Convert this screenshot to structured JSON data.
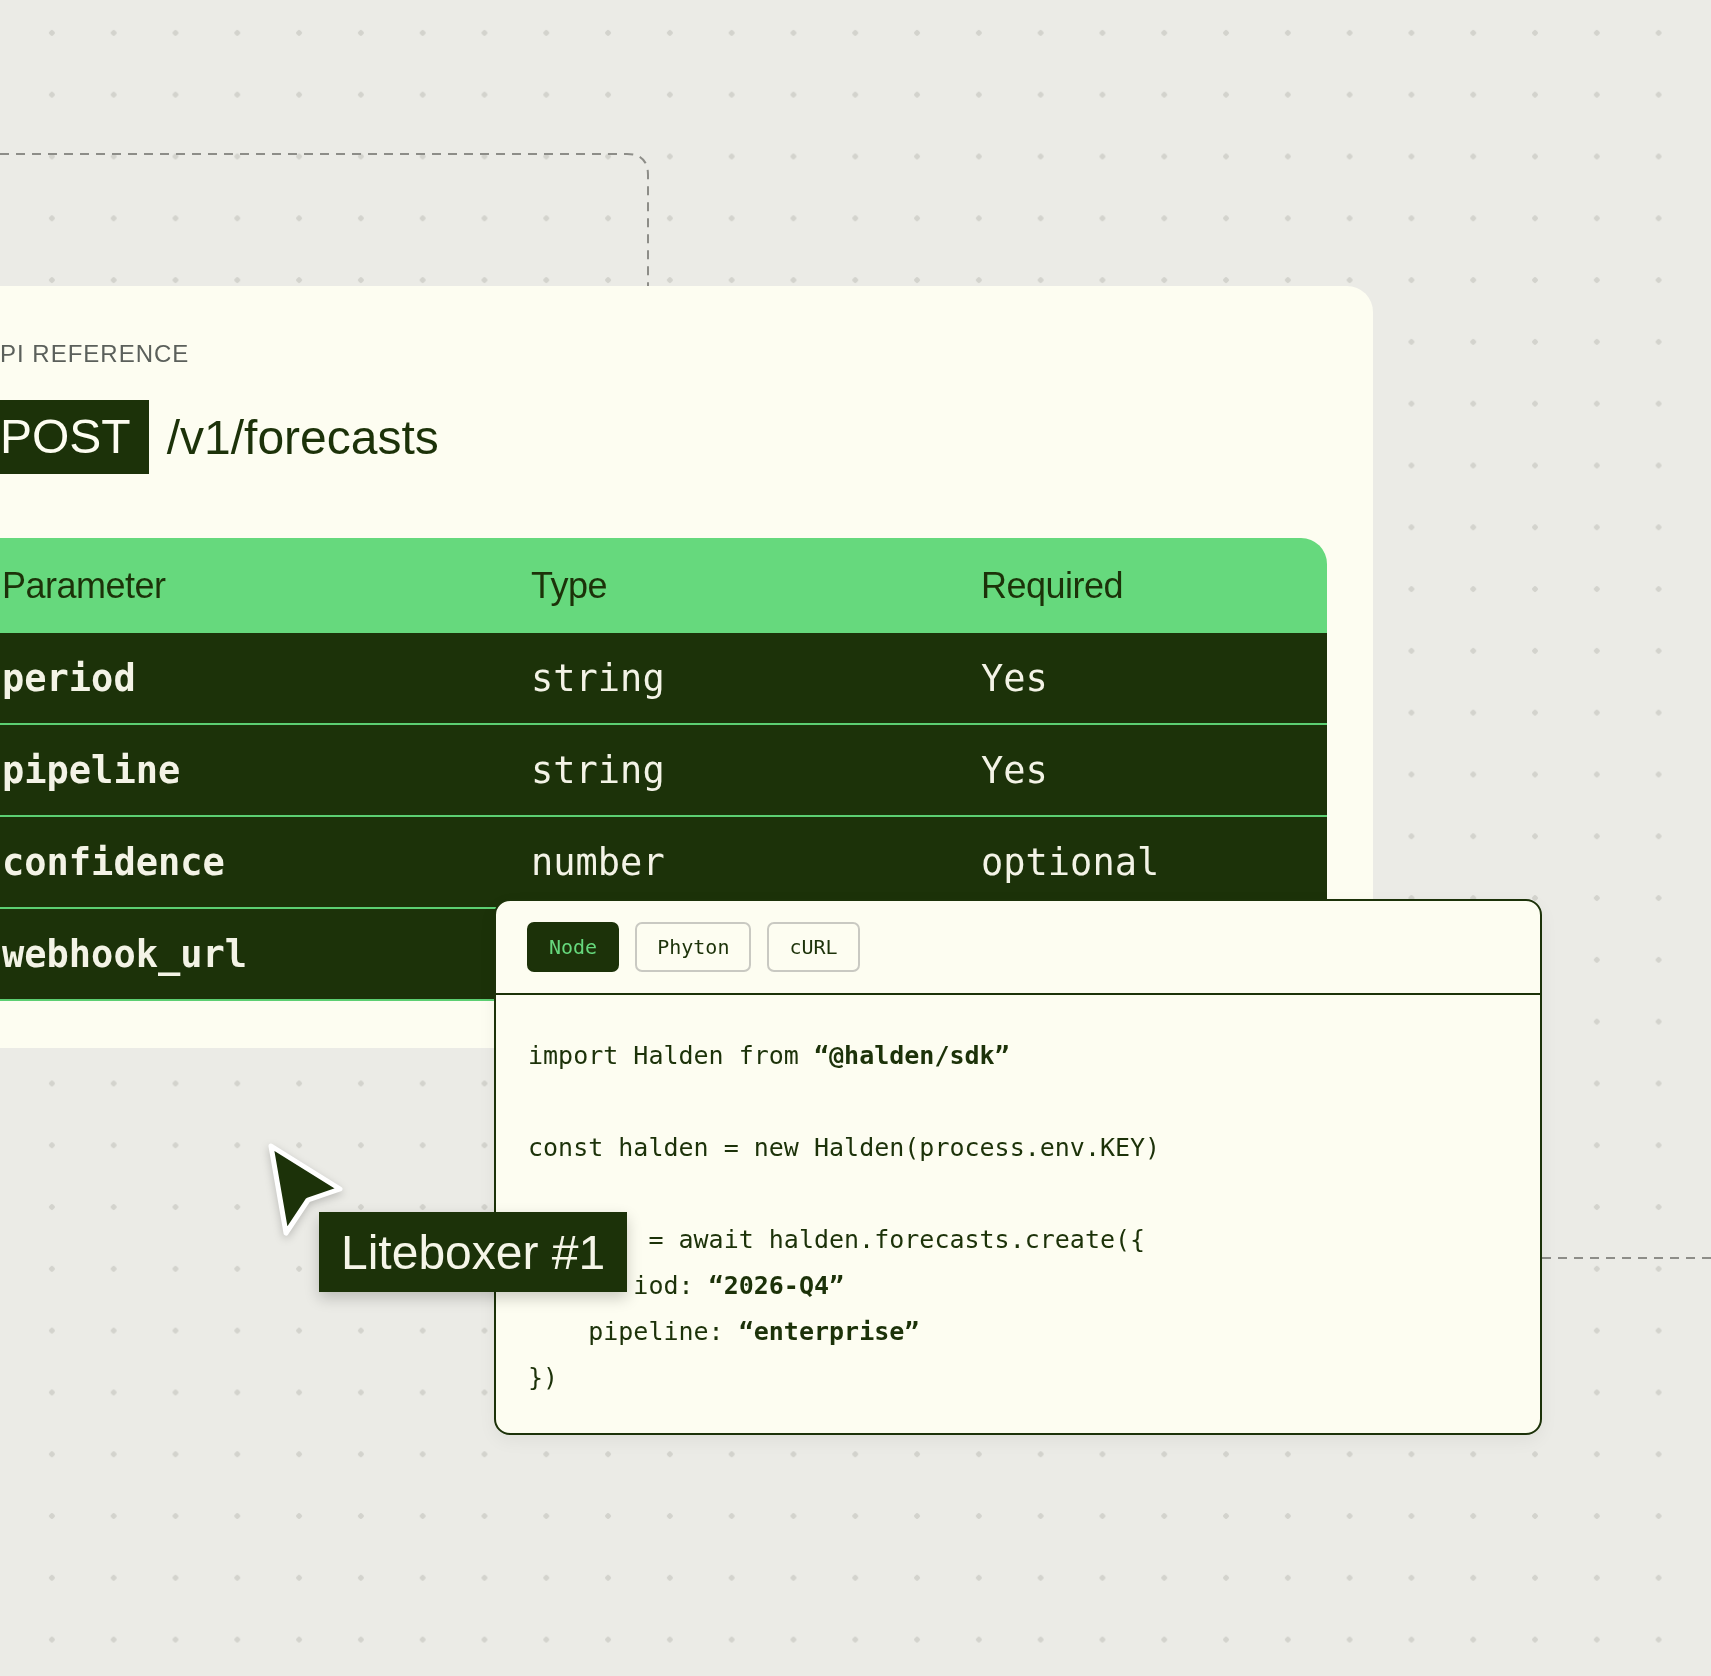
{
  "eyebrow": "PI REFERENCE",
  "endpoint": {
    "method": "POST",
    "path": "/v1/forecasts"
  },
  "table": {
    "columns": [
      "Parameter",
      "Type",
      "Required"
    ],
    "rows": [
      {
        "parameter": "period",
        "type": "string",
        "required": "Yes"
      },
      {
        "parameter": "pipeline",
        "type": "string",
        "required": "Yes"
      },
      {
        "parameter": "confidence",
        "type": "number",
        "required": "optional"
      },
      {
        "parameter": "webhook_url"
      }
    ]
  },
  "code_panel": {
    "tabs": [
      {
        "label": "Node",
        "selected": true
      },
      {
        "label": "Phyton",
        "selected": false
      },
      {
        "label": "cURL",
        "selected": false
      }
    ],
    "blocks": [
      {
        "lines": [
          {
            "text": "import Halden from **“@halden/sdk”**",
            "covered": false
          }
        ]
      },
      {
        "lines": [
          {
            "text": "const halden = new Halden(process.env.KEY)",
            "covered": false
          }
        ]
      },
      {
        "lines": [
          {
            "text": "= await halden.forecasts.create({",
            "covered": true,
            "children": [
              {
                "text": "iod: **“2026-Q4”**",
                "covered": true
              },
              {
                "text": "pipeline: **“enterprise”**",
                "covered": false
              }
            ]
          },
          {
            "text": "})",
            "covered": false
          }
        ]
      }
    ]
  },
  "cursor": {
    "label": "Liteboxer #1"
  }
}
